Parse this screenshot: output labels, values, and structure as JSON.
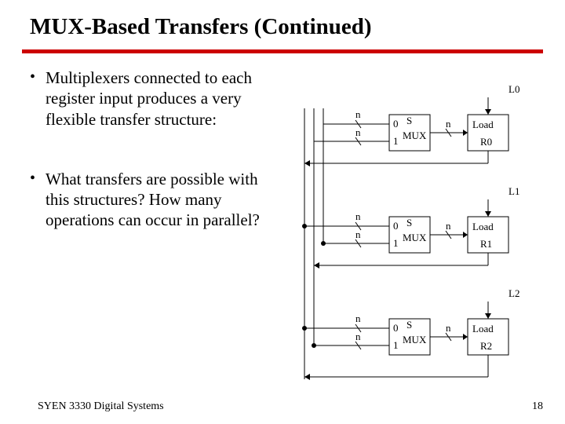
{
  "title": "MUX-Based Transfers (Continued)",
  "bullets": [
    "Multiplexers connected to each register input produces a very flexible transfer structure:",
    "What transfers are possible with this structures?   How many operations can occur in parallel?"
  ],
  "footer": {
    "left": "SYEN 3330 Digital Systems",
    "page": "18"
  },
  "diagram": {
    "bus_label": "n",
    "mux": {
      "label": "MUX",
      "select": "S",
      "in0": "0",
      "in1": "1"
    },
    "registers": [
      {
        "load_ctrl": "L0",
        "load": "Load",
        "name": "R0"
      },
      {
        "load_ctrl": "L1",
        "load": "Load",
        "name": "R1"
      },
      {
        "load_ctrl": "L2",
        "load": "Load",
        "name": "R2"
      }
    ]
  }
}
